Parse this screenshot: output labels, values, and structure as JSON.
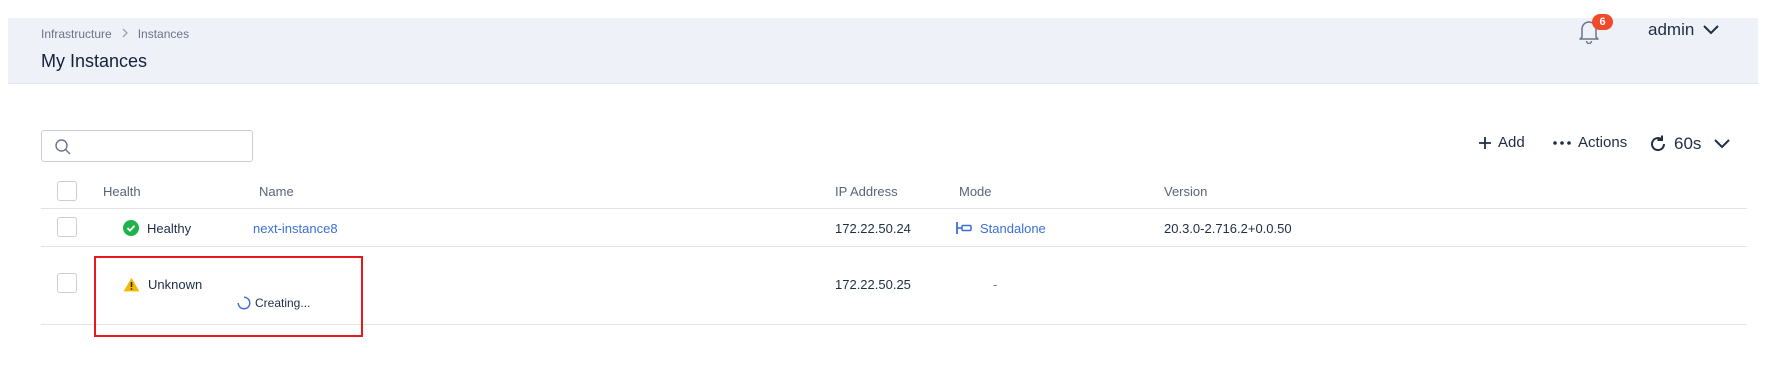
{
  "header": {
    "breadcrumb": [
      "Infrastructure",
      "Instances"
    ],
    "title": "My Instances",
    "notifications_count": "6",
    "user": "admin"
  },
  "search": {
    "value": "",
    "placeholder": ""
  },
  "toolbar": {
    "add_label": "Add",
    "actions_label": "Actions",
    "refresh_interval": "60s"
  },
  "table": {
    "columns": {
      "health": "Health",
      "name": "Name",
      "ip": "IP Address",
      "mode": "Mode",
      "version": "Version"
    },
    "rows": [
      {
        "health": "Healthy",
        "health_status": "ok",
        "name": "next-instance8",
        "ip": "172.22.50.24",
        "mode": "Standalone",
        "version": "20.3.0-2.716.2+0.0.50"
      },
      {
        "health": "Unknown",
        "health_status": "warning",
        "status_text": "Creating...",
        "ip": "172.22.50.25",
        "mode": "-"
      }
    ]
  },
  "colors": {
    "accent": "#3b6fd8",
    "healthy": "#22b14c",
    "warning": "#f5b800",
    "badge": "#f04a2a",
    "highlight": "#e5191d"
  }
}
